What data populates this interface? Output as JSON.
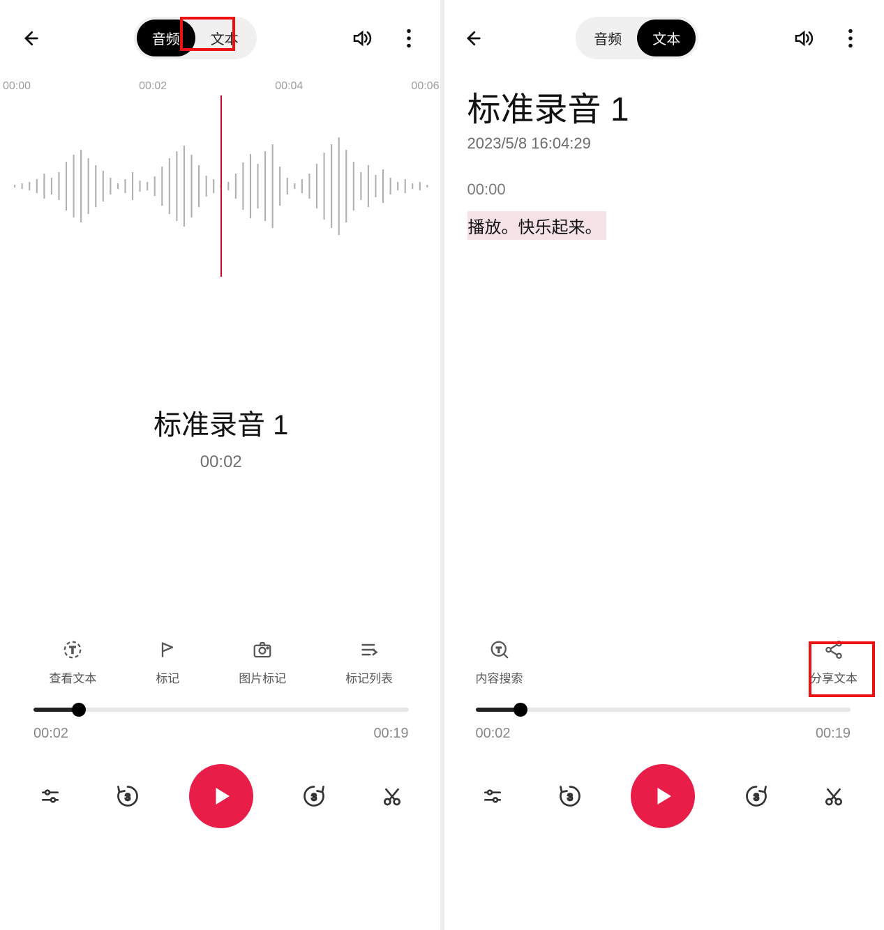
{
  "tabs": {
    "audio": "音频",
    "text": "文本"
  },
  "left": {
    "time_ticks": [
      "00:00",
      "00:02",
      "00:04",
      "00:06"
    ],
    "title": "标准录音 1",
    "time": "00:02",
    "actions": {
      "view_text": "查看文本",
      "mark": "标记",
      "image_mark": "图片标记",
      "mark_list": "标记列表"
    },
    "slider": {
      "current": "00:02",
      "total": "00:19"
    }
  },
  "right": {
    "title": "标准录音 1",
    "date": "2023/5/8 16:04:29",
    "stamp": "00:00",
    "transcript": "播放。快乐起来。",
    "actions": {
      "search": "内容搜索",
      "share": "分享文本"
    },
    "slider": {
      "current": "00:02",
      "total": "00:19"
    }
  }
}
